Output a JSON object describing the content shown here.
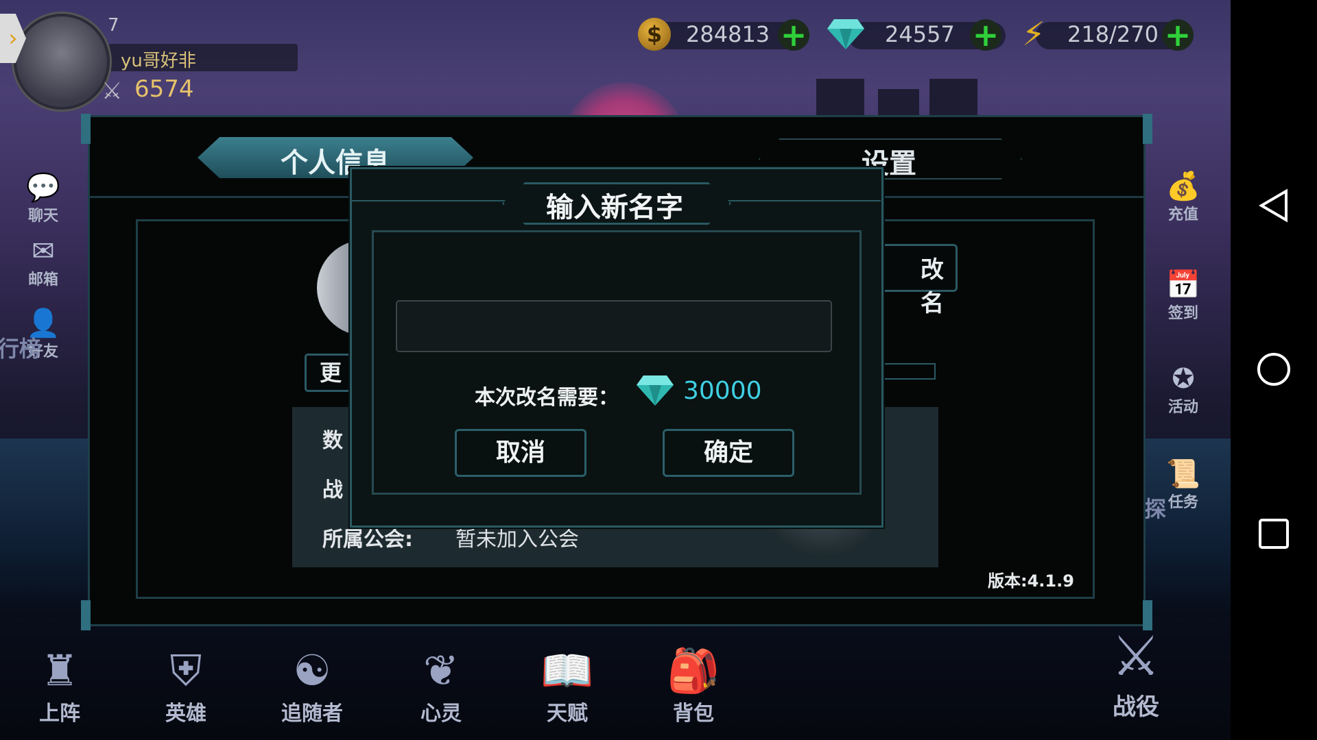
{
  "player": {
    "level": "7",
    "name": "yu哥好非",
    "power": "6574"
  },
  "currencies": {
    "gold": "284813",
    "diamonds": "24557",
    "energy": "218/270"
  },
  "left_menu": [
    {
      "label": "聊天",
      "icon": "chat-icon"
    },
    {
      "label": "邮箱",
      "icon": "mail-icon"
    },
    {
      "label": "好友",
      "icon": "friends-icon"
    }
  ],
  "left_peek_label": "行榜",
  "right_menu": [
    {
      "label": "充值",
      "icon": "moneybag-icon"
    },
    {
      "label": "签到",
      "icon": "calendar-check-icon"
    },
    {
      "label": "活动",
      "icon": "event-icon"
    },
    {
      "label": "任务",
      "icon": "quest-scroll-icon"
    }
  ],
  "right_peek_label": "探",
  "bottom_menu": [
    {
      "label": "上阵",
      "icon": "formation-icon"
    },
    {
      "label": "英雄",
      "icon": "hero-armor-icon"
    },
    {
      "label": "追随者",
      "icon": "follower-icon"
    },
    {
      "label": "心灵",
      "icon": "spirit-wings-icon"
    },
    {
      "label": "天赋",
      "icon": "talent-book-icon"
    },
    {
      "label": "背包",
      "icon": "backpack-icon"
    }
  ],
  "battle": {
    "label": "战役",
    "icon": "crossed-swords-icon"
  },
  "panel": {
    "tab_profile": "个人信息",
    "tab_settings": "设置",
    "rename_btn_fragment": "改名",
    "change_btn_fragment": "更",
    "row1_fragment": "数",
    "row2_fragment": "战",
    "guild_label": "所属公会:",
    "guild_value": "暂未加入公会",
    "version": "版本:4.1.9"
  },
  "dialog": {
    "title": "输入新名字",
    "input_value": "",
    "cost_label": "本次改名需要：",
    "cost_value": "30000",
    "cancel": "取消",
    "confirm": "确定"
  },
  "colors": {
    "accent_teal": "#2a5a63",
    "cost_cyan": "#3fd0e3",
    "plus_green": "#2fd03a",
    "gold_text": "#e6c26b"
  }
}
